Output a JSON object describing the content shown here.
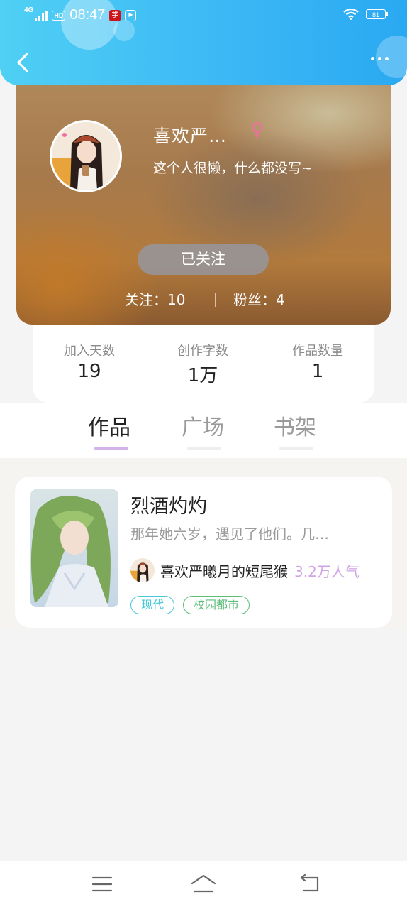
{
  "status_bar": {
    "network": "4G",
    "hd": "HD",
    "time": "08:47",
    "app_badge": "学",
    "app_badge2": "▶",
    "battery": "81"
  },
  "nav": {
    "back_icon": "chevron-left-icon",
    "more_icon": "more-dots-icon"
  },
  "profile": {
    "username": "喜欢严…",
    "gender_symbol": "♀",
    "bio": "这个人很懒，什么都没写~",
    "follow_button": "已关注",
    "following": "关注：10",
    "fans": "粉丝：4"
  },
  "stats": [
    {
      "label": "加入天数",
      "value": "19"
    },
    {
      "label": "创作字数",
      "value": "1万"
    },
    {
      "label": "作品数量",
      "value": "1"
    }
  ],
  "tabs": [
    {
      "label": "作品",
      "active": true
    },
    {
      "label": "广场",
      "active": false
    },
    {
      "label": "书架",
      "active": false
    }
  ],
  "work": {
    "title": "烈酒灼灼",
    "description": "那年她六岁，遇见了他们。几…",
    "author": "喜欢严曦月的短尾猴",
    "popularity": "3.2万人气",
    "tags": [
      {
        "label": "现代",
        "color": "#45c8d8"
      },
      {
        "label": "校园都市",
        "color": "#5fbe7c"
      }
    ]
  },
  "bottom_nav": {
    "menu_icon": "menu-icon",
    "home_icon": "home-icon",
    "back_icon": "back-arrow-icon"
  },
  "colors": {
    "header": "#3cb8f5",
    "active_tab_text": "#222222",
    "inactive_tab_text": "#9a9a9a",
    "active_tab_underline": "#d3b3ec",
    "inactive_tab_underline": "#eeeeee",
    "popularity": "#d0a4e4"
  }
}
